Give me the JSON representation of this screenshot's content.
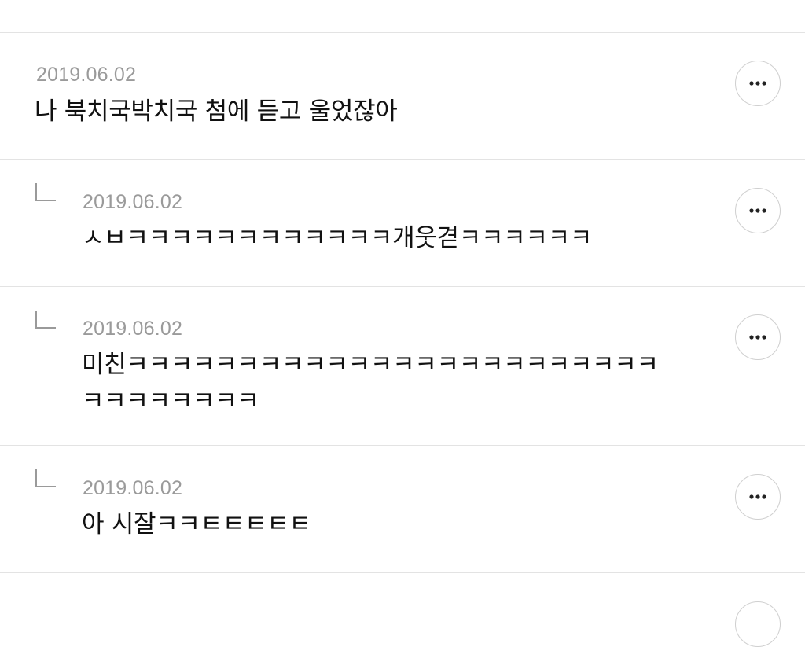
{
  "comments": [
    {
      "date": "2019.06.02",
      "text": "나 북치국박치국 첨에 듣고 울었잖아",
      "reply": false
    },
    {
      "date": "2019.06.02",
      "text": "ㅅㅂㅋㅋㅋㅋㅋㅋㅋㅋㅋㅋㅋㅋ개웃겯ㅋㅋㅋㅋㅋㅋ",
      "reply": true
    },
    {
      "date": "2019.06.02",
      "text": "미친ㅋㅋㅋㅋㅋㅋㅋㅋㅋㅋㅋㅋㅋㅋㅋㅋㅋㅋㅋㅋㅋㅋㅋㅋ\nㅋㅋㅋㅋㅋㅋㅋㅋ",
      "reply": true
    },
    {
      "date": "2019.06.02",
      "text": "아 시잘ㅋㅋㅌㅌㅌㅌㅌ",
      "reply": true
    }
  ],
  "icons": {
    "more": "more-options-icon",
    "reply": "reply-arrow-icon"
  }
}
